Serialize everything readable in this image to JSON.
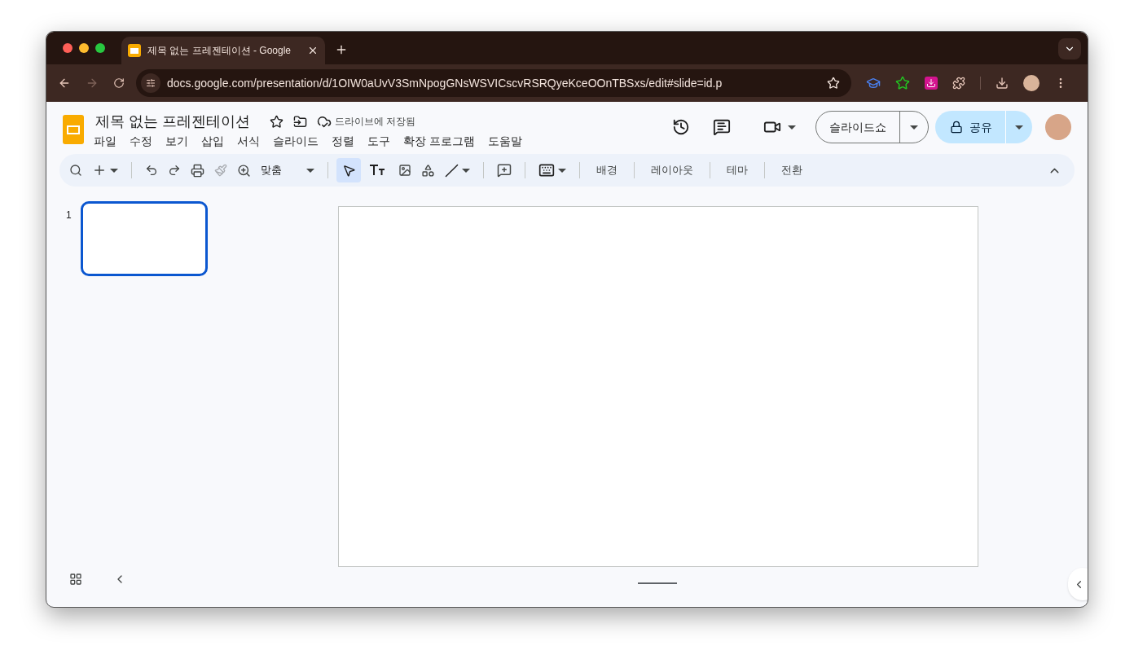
{
  "browser": {
    "tab": {
      "title": "제목 없는 프레젠테이션 - Google",
      "selected": true
    },
    "url": "docs.google.com/presentation/d/1OIW0aUvV3SmNpogGNsWSVICscvRSRQyeKceOOnTBSxs/edit#slide=id.p",
    "forward_disabled": true
  },
  "doc": {
    "title": "제목 없는 프레젠테이션",
    "save_status": "드라이브에 저장됨"
  },
  "menu": [
    "파일",
    "수정",
    "보기",
    "삽입",
    "서식",
    "슬라이드",
    "정렬",
    "도구",
    "확장 프로그램",
    "도움말"
  ],
  "actions": {
    "slideshow": "슬라이드쇼",
    "share": "공유"
  },
  "toolbar": {
    "zoom": "맞춤",
    "paint_format_disabled": true,
    "pointer_selected": true,
    "text_buttons": [
      "배경",
      "레이아웃",
      "테마",
      "전환"
    ]
  },
  "slides": [
    {
      "number": "1",
      "selected": true
    }
  ]
}
